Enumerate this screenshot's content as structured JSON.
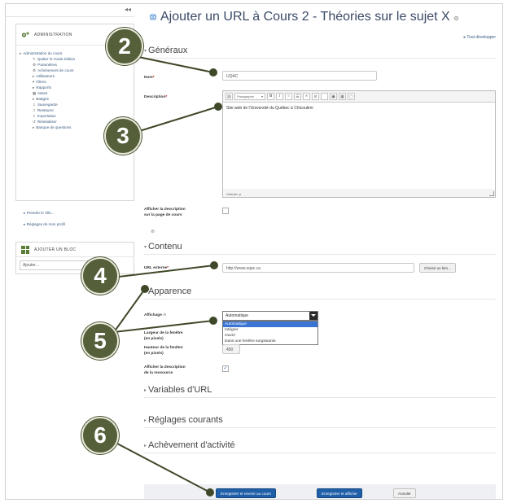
{
  "page": {
    "title": "Ajouter un URL à Cours 2 - Théories sur le sujet X",
    "help_glyph": "⊚",
    "expand_all": "▸ Tout développer"
  },
  "sidebar": {
    "admin_header": "ADMINISTRATION",
    "course_admin": "Administration du cours",
    "items": [
      "Quitter le mode édition",
      "Paramètres",
      "Achèvement de cours",
      "Utilisateurs",
      "Filtres",
      "Rapports",
      "Notes",
      "Badges",
      "Sauvegarde",
      "Restaurer",
      "Importation",
      "Réinitialiser",
      "Banque de questions"
    ],
    "links": [
      "Prendre le rôle...",
      "Réglages de mon profil"
    ],
    "addblock_header": "AJOUTER UN BLOC",
    "addblock_select": "Ajouter..."
  },
  "sections": {
    "general": "Généraux",
    "content": "Contenu",
    "appearance": "Apparence",
    "url_vars": "Variables d'URL",
    "common": "Réglages courants",
    "completion": "Achèvement d'activité"
  },
  "form": {
    "name_label": "Nom",
    "name_value": "UQAC",
    "desc_label": "Description",
    "toolbar_paragraph": "Paragraphe",
    "desc_text": "Site web de l'Université du Québec à Chicoutimi",
    "editor_path": "Chemin: p",
    "show_desc_label_1": "Afficher la description",
    "show_desc_label_2": "sur la page de cours",
    "url_label": "URL externe",
    "url_value": "http://www.uqac.ca",
    "choose_link": "Choisir un lien...",
    "display_label": "Affichage",
    "display_selected": "Automatique",
    "display_options": [
      "Automatique",
      "Intégrer",
      "Ouvrir",
      "Dans une fenêtre surgissante"
    ],
    "width_label_1": "Largeur de la fenêtre",
    "width_label_2": "(en pixels)",
    "height_label_1": "Hauteur de la fenêtre",
    "height_label_2": "(en pixels)",
    "height_value": "450",
    "res_desc_label_1": "Afficher la description",
    "res_desc_label_2": "de la ressource",
    "required_mark": "*"
  },
  "buttons": {
    "save_return": "Enregistrer et revenir au cours",
    "save_display": "Enregistrer et afficher",
    "cancel": "Annuler"
  },
  "callouts": [
    "2",
    "3",
    "4",
    "5",
    "6"
  ],
  "colors": {
    "callout": "#555f3a",
    "primary": "#1f5fa8",
    "link": "#3a5a80"
  }
}
